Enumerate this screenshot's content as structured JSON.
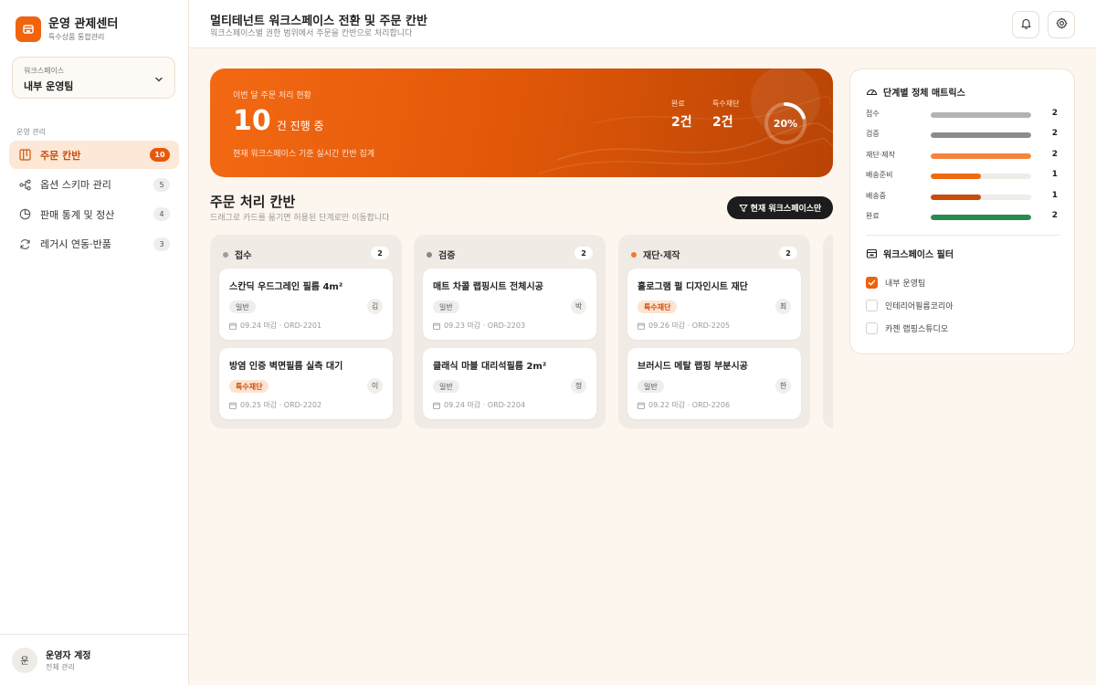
{
  "sidebar": {
    "brand_title": "운영 관제센터",
    "brand_sub": "특수상품 통합관리",
    "workspace_label": "워크스페이스",
    "workspace_value": "내부 운영팀",
    "nav_heading": "운영 관리",
    "items": [
      {
        "label": "주문 칸반",
        "badge": "10",
        "icon": "kanban-icon",
        "active": true
      },
      {
        "label": "옵션 스키마 관리",
        "badge": "5",
        "icon": "schema-icon",
        "active": false
      },
      {
        "label": "판매 통계 및 정산",
        "badge": "4",
        "icon": "pie-chart-icon",
        "active": false
      },
      {
        "label": "레거시 연동·반품",
        "badge": "3",
        "icon": "refresh-icon",
        "active": false
      }
    ],
    "account_avatar": "운",
    "account_name": "운영자 계정",
    "account_role": "전체 관리"
  },
  "header": {
    "title": "멀티테넌트 워크스페이스 전환 및 주문 칸반",
    "subtitle": "워크스페이스별 권한 범위에서 주문을 칸반으로 처리합니다"
  },
  "hero": {
    "kicker": "이번 달 주문 처리 현황",
    "count": "10",
    "count_unit": "건 진행 중",
    "description": "현재 워크스페이스 기준 실시간 칸반 집계",
    "stats": [
      {
        "label": "완료",
        "value": "2건"
      },
      {
        "label": "특수재단",
        "value": "2건"
      }
    ],
    "progress_label": "20%",
    "progress_value": 20
  },
  "kanban": {
    "title": "주문 처리 칸반",
    "subtitle": "드래그로 카드를 옮기면 허용된 단계로만 이동합니다",
    "filter_button": "현재 워크스페이스만",
    "columns": [
      {
        "name": "접수",
        "count": "2",
        "dot_color": "#9e9e9e",
        "cards": [
          {
            "title": "스칸딕 우드그레인 필름 4m²",
            "tag": "일반",
            "special": false,
            "avatar": "김",
            "meta": "09.24 마감 · ORD-2201"
          },
          {
            "title": "방염 인증 벽면필름 실측 대기",
            "tag": "특수재단",
            "special": true,
            "avatar": "이",
            "meta": "09.25 마감 · ORD-2202"
          }
        ]
      },
      {
        "name": "검증",
        "count": "2",
        "dot_color": "#888888",
        "cards": [
          {
            "title": "매트 차콜 랩핑시트 전체시공",
            "tag": "일반",
            "special": false,
            "avatar": "박",
            "meta": "09.23 마감 · ORD-2203"
          },
          {
            "title": "클래식 마블 대리석필름 2m²",
            "tag": "일반",
            "special": false,
            "avatar": "정",
            "meta": "09.24 마감 · ORD-2204"
          }
        ]
      },
      {
        "name": "재단·제작",
        "count": "2",
        "dot_color": "#f07a2a",
        "cards": [
          {
            "title": "홀로그램 펄 디자인시트 재단",
            "tag": "특수재단",
            "special": true,
            "avatar": "최",
            "meta": "09.26 마감 · ORD-2205"
          },
          {
            "title": "브러시드 메탈 랩핑 부분시공",
            "tag": "일반",
            "special": false,
            "avatar": "한",
            "meta": "09.22 마감 · ORD-2206"
          }
        ]
      }
    ]
  },
  "matrix": {
    "title": "단계별 정체 매트릭스",
    "rows": [
      {
        "label": "접수",
        "value": "2",
        "fraction": 1.0,
        "color": "#b3b3b3"
      },
      {
        "label": "검증",
        "value": "2",
        "fraction": 1.0,
        "color": "#8c8c8c"
      },
      {
        "label": "재단·제작",
        "value": "2",
        "fraction": 1.0,
        "color": "#f5843a"
      },
      {
        "label": "배송준비",
        "value": "1",
        "fraction": 0.5,
        "color": "#ee6a12"
      },
      {
        "label": "배송중",
        "value": "1",
        "fraction": 0.5,
        "color": "#c94c0b"
      },
      {
        "label": "완료",
        "value": "2",
        "fraction": 1.0,
        "color": "#2a8a51"
      }
    ]
  },
  "filter": {
    "title": "워크스페이스 필터",
    "options": [
      {
        "label": "내부 운영팀",
        "checked": true
      },
      {
        "label": "인테리어필름코리아",
        "checked": false
      },
      {
        "label": "카젠 랩핑스튜디오",
        "checked": false
      }
    ]
  }
}
